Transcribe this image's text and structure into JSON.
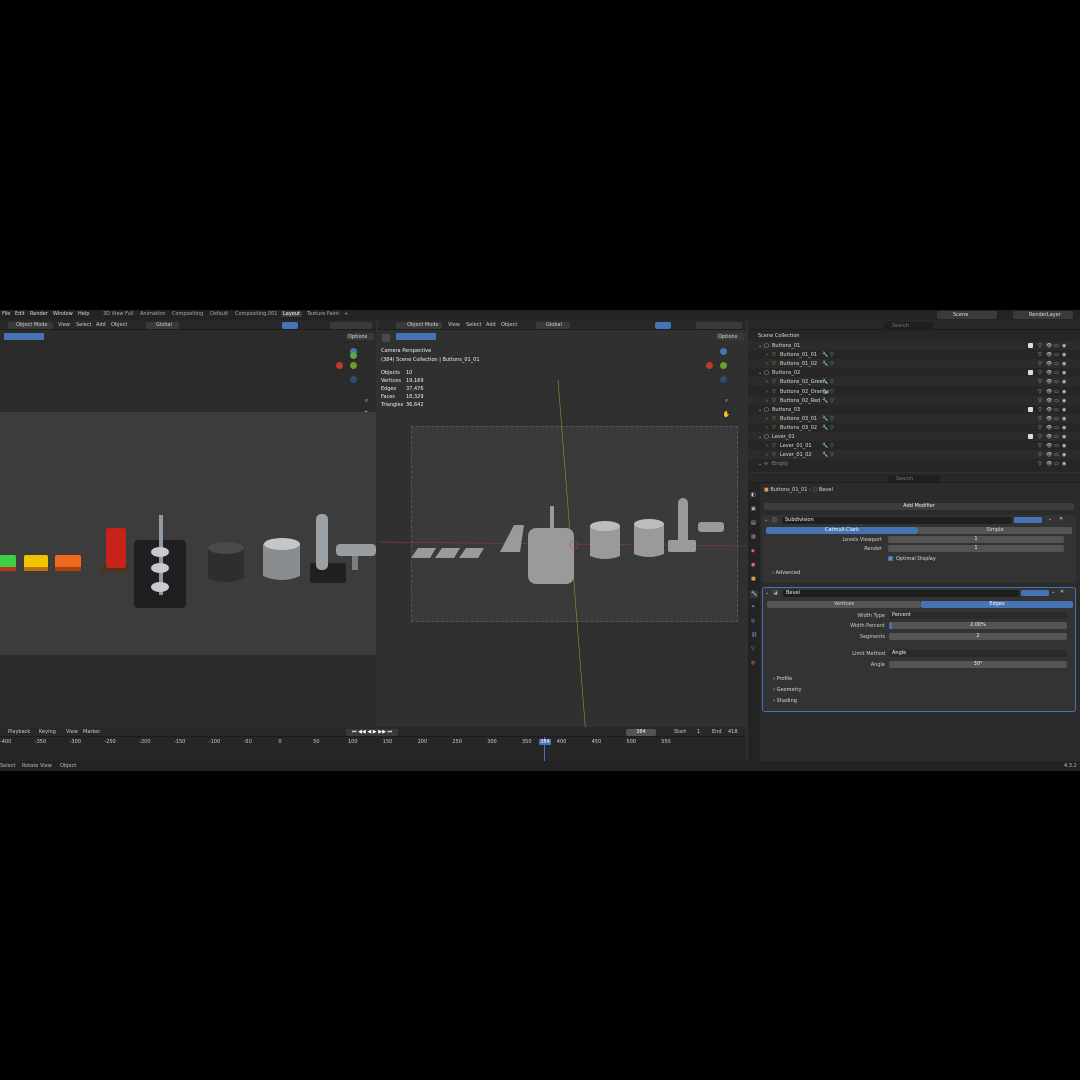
{
  "menus": [
    "File",
    "Edit",
    "Render",
    "Window",
    "Help"
  ],
  "workspaces": [
    "3D View Full",
    "Animation",
    "Compositing",
    "Default",
    "Compositing.001",
    "Layout",
    "Texture Paint",
    "+"
  ],
  "active_workspace": "Layout",
  "scene": {
    "label": "Scene",
    "render_layer": "RenderLayer"
  },
  "left_view": {
    "mode": "Object Mode",
    "menus": [
      "View",
      "Select",
      "Add",
      "Object"
    ],
    "orientation": "Global",
    "options": "Options"
  },
  "right_view": {
    "mode": "Object Mode",
    "menus": [
      "View",
      "Select",
      "Add",
      "Object"
    ],
    "orientation": "Global",
    "options": "Options",
    "camera": "Camera Perspective",
    "collection": "(384) Scene Collection | Buttons_01_01",
    "stats": [
      {
        "k": "Objects",
        "v": "10"
      },
      {
        "k": "Vertices",
        "v": "19,169"
      },
      {
        "k": "Edges",
        "v": "37,476"
      },
      {
        "k": "Faces",
        "v": "18,329"
      },
      {
        "k": "Triangles",
        "v": "36,642"
      }
    ]
  },
  "outliner": {
    "search_placeholder": "Search",
    "root": "Scene Collection",
    "rows": [
      {
        "name": "Buttons_01",
        "type": "collection",
        "indent": 1
      },
      {
        "name": "Buttons_01_01",
        "type": "object",
        "indent": 2
      },
      {
        "name": "Buttons_01_02",
        "type": "object",
        "indent": 2
      },
      {
        "name": "Buttons_02",
        "type": "collection",
        "indent": 1
      },
      {
        "name": "Buttons_02_Green",
        "type": "object",
        "indent": 2
      },
      {
        "name": "Buttons_02_Orange",
        "type": "object",
        "indent": 2
      },
      {
        "name": "Buttons_02_Red",
        "type": "object",
        "indent": 2
      },
      {
        "name": "Buttons_03",
        "type": "collection",
        "indent": 1
      },
      {
        "name": "Buttons_03_01",
        "type": "object",
        "indent": 2
      },
      {
        "name": "Buttons_03_02",
        "type": "object",
        "indent": 2
      },
      {
        "name": "Lever_01",
        "type": "collection",
        "indent": 1
      },
      {
        "name": "Lever_01_01",
        "type": "object",
        "indent": 2
      },
      {
        "name": "Lever_01_02",
        "type": "object",
        "indent": 2
      },
      {
        "name": "Empty",
        "type": "empty",
        "indent": 1
      }
    ]
  },
  "properties": {
    "search_placeholder": "Search",
    "breadcrumb_object": "Buttons_01_01",
    "breadcrumb_modifier": "Bevel",
    "add_modifier": "Add Modifier",
    "subdivision": {
      "name": "Subdivision",
      "tabs": [
        "Catmull-Clark",
        "Simple"
      ],
      "levels_viewport_label": "Levels Viewport",
      "levels_viewport": "1",
      "render_label": "Render",
      "render": "1",
      "optimal_display": "Optimal Display",
      "advanced": "Advanced"
    },
    "bevel": {
      "name": "Bevel",
      "tabs": [
        "Vertices",
        "Edges"
      ],
      "width_type_label": "Width Type",
      "width_type": "Percent",
      "width_percent_label": "Width Percent",
      "width_percent": "2.00%",
      "segments_label": "Segments",
      "segments": "2",
      "limit_method_label": "Limit Method",
      "limit_method": "Angle",
      "angle_label": "Angle",
      "angle": "30°",
      "subpanels": [
        "Profile",
        "Geometry",
        "Shading"
      ]
    }
  },
  "timeline": {
    "menus": [
      "Playback",
      "Keying",
      "View",
      "Marker"
    ],
    "current_frame": "384",
    "start_label": "Start",
    "start": "1",
    "end_label": "End",
    "end": "418",
    "ticks": [
      "-400",
      "-350",
      "-300",
      "-250",
      "-200",
      "-150",
      "-100",
      "-50",
      "0",
      "50",
      "100",
      "150",
      "200",
      "250",
      "300",
      "350",
      "400",
      "450",
      "500",
      "550"
    ]
  },
  "status": {
    "items": [
      "Select",
      "Rotate View",
      "Object"
    ],
    "version": "4.3.2"
  },
  "colors": {
    "accent": "#4772b3",
    "orange": "#e59b4c",
    "green": "#5fcf9a",
    "red": "#e0473b",
    "yellow": "#f0c000"
  }
}
